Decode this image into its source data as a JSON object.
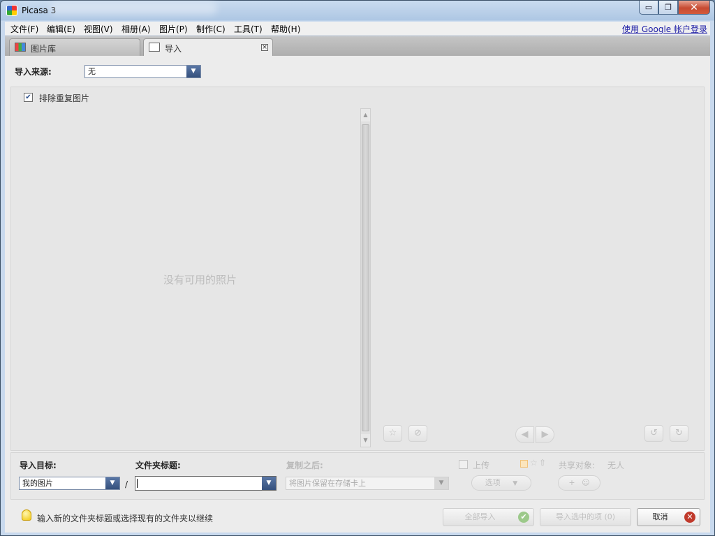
{
  "window": {
    "title": "Picasa 3",
    "controls": {
      "minimize": "▭",
      "restore": "❐",
      "close": "✕"
    }
  },
  "menu": {
    "items": [
      "文件(F)",
      "编辑(E)",
      "视图(V)",
      "相册(A)",
      "图片(P)",
      "制作(C)",
      "工具(T)",
      "帮助(H)"
    ],
    "signin_link": "使用 Google 帐户登录"
  },
  "tabs": [
    {
      "label": "图片库",
      "active": false
    },
    {
      "label": "导入",
      "active": true
    }
  ],
  "import_source": {
    "label": "导入来源:",
    "value": "无"
  },
  "preview": {
    "exclude_duplicates": {
      "label": "排除重复图片",
      "checked": true
    },
    "empty_message": "没有可用的照片"
  },
  "bottom": {
    "target": {
      "label": "导入目标:",
      "value": "我的图片"
    },
    "separator": "/",
    "folder_title": {
      "label": "文件夹标题:",
      "value": ""
    },
    "after_copy": {
      "label": "复制之后:",
      "value": "将图片保留在存储卡上"
    },
    "upload": {
      "label": "上传",
      "checked": false
    },
    "options_button": "选项",
    "share": {
      "label": "共享对象:",
      "value": "无人"
    },
    "share_add_button": "+"
  },
  "status": {
    "hint": "输入新的文件夹标题或选择现有的文件夹以继续"
  },
  "actions": {
    "import_all": "全部导入",
    "import_selected": "导入选中的项 (0)",
    "cancel": "取消"
  },
  "colors": {
    "accent": "#34507c",
    "cancel_icon": "#c0392b",
    "ok_icon": "#8fbf7a"
  }
}
